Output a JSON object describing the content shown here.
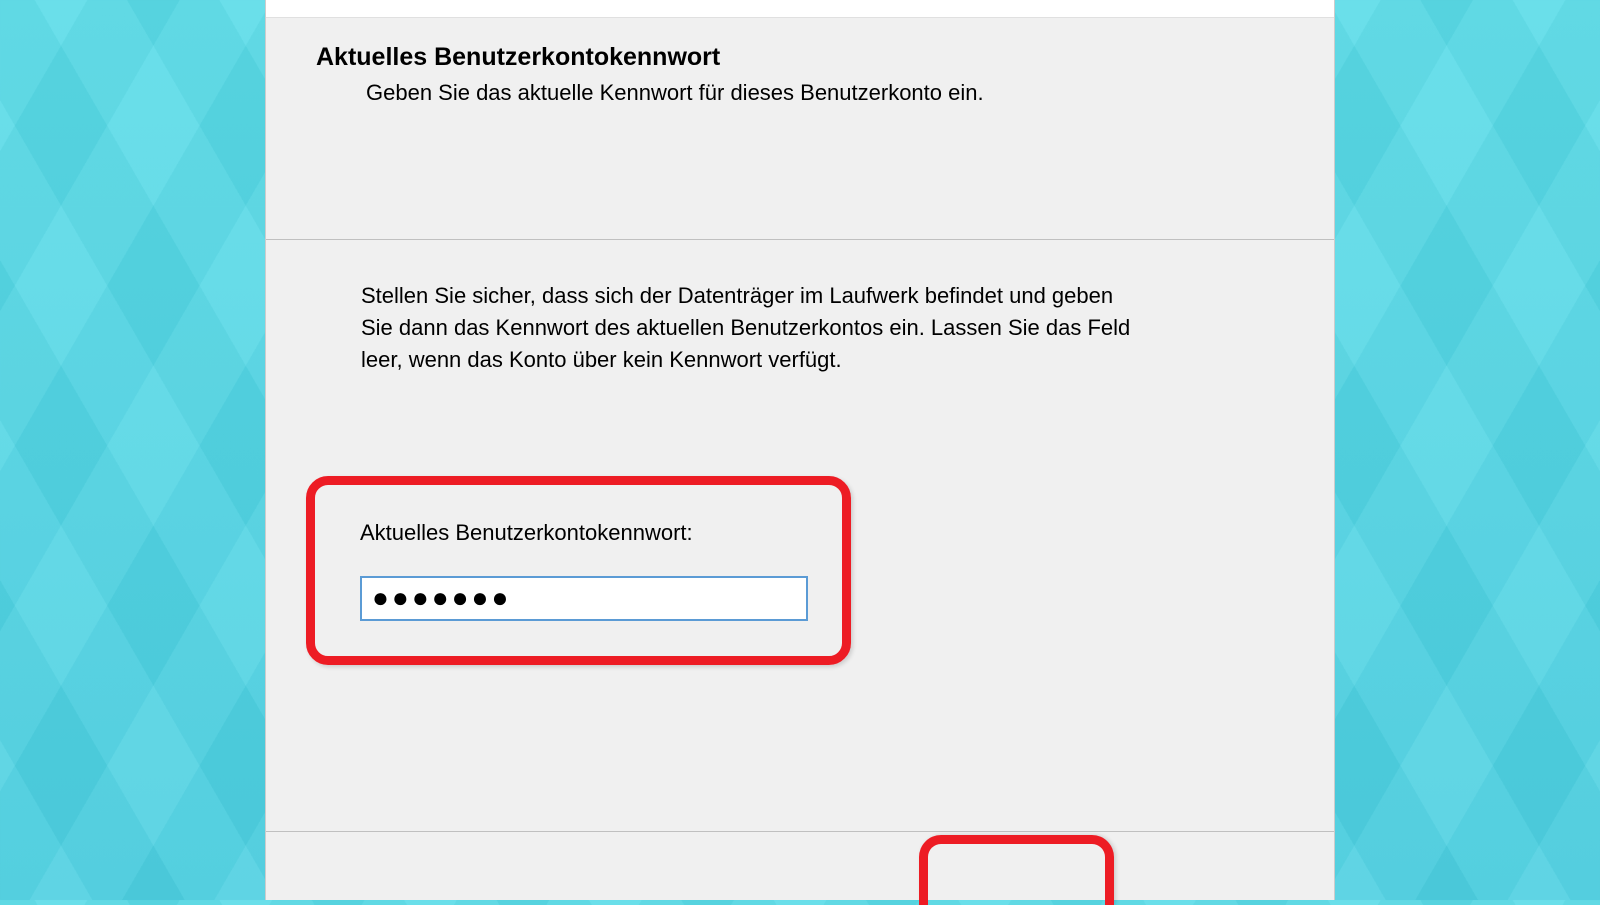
{
  "header": {
    "title": "Aktuelles Benutzerkontokennwort",
    "subtitle": "Geben Sie das aktuelle Kennwort für dieses Benutzerkonto ein."
  },
  "body": {
    "instruction": "Stellen Sie sicher, dass sich der Datenträger im Laufwerk befindet und geben Sie dann das Kennwort des aktuellen Benutzerkontos ein. Lassen Sie das Feld leer, wenn das Konto über kein Kennwort verfügt."
  },
  "field": {
    "label": "Aktuelles Benutzerkontokennwort:",
    "value": "●●●●●●●"
  }
}
